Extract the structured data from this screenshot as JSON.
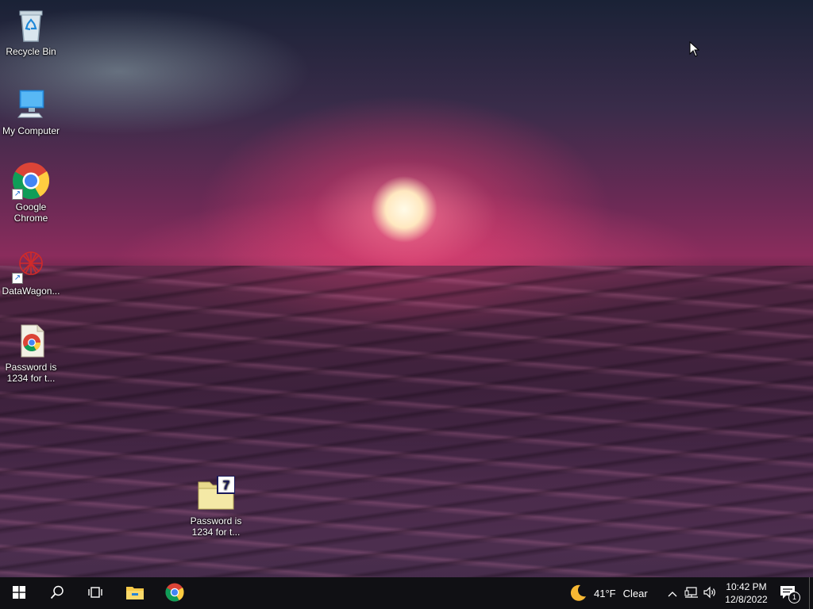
{
  "desktop": {
    "icons": [
      {
        "label": "Recycle Bin",
        "icon": "recycle-bin-icon"
      },
      {
        "label": "My Computer",
        "icon": "computer-icon"
      },
      {
        "label": "Google Chrome",
        "icon": "chrome-icon"
      },
      {
        "label": "DataWagon...",
        "icon": "datawagon-icon"
      },
      {
        "label": "Password is 1234 for t...",
        "icon": "chrome-file-icon"
      },
      {
        "label": "Password is 1234 for t...",
        "icon": "7zip-archive-icon"
      }
    ]
  },
  "taskbar": {
    "start_icon": "windows-start-icon",
    "search_icon": "search-icon",
    "task_view_icon": "task-view-icon",
    "pinned": [
      {
        "name": "File Explorer",
        "icon": "file-explorer-icon"
      },
      {
        "name": "Google Chrome",
        "icon": "chrome-icon"
      }
    ],
    "weather": {
      "temp": "41°F",
      "condition": "Clear",
      "icon": "moon-icon"
    },
    "tray": {
      "chevron_icon": "chevron-up-icon",
      "network_icon": "network-icon",
      "volume_icon": "volume-icon"
    },
    "clock": {
      "time": "10:42 PM",
      "date": "12/8/2022"
    },
    "notifications": {
      "count": "1",
      "icon": "notification-icon"
    }
  }
}
